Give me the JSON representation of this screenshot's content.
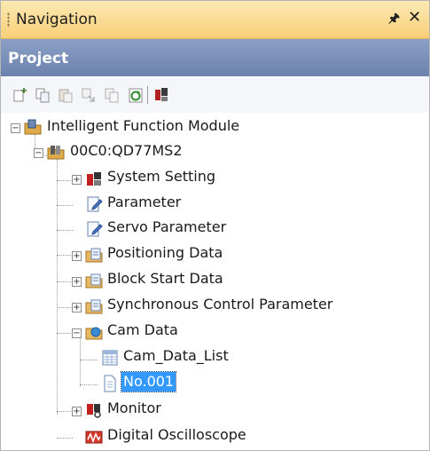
{
  "panel": {
    "title": "Navigation",
    "pin_glyph": "p ",
    "close_glyph": "×"
  },
  "project": {
    "label": "Project"
  },
  "toolbar": {
    "buttons": [
      "new-item-icon",
      "copy-icon",
      "paste-icon",
      "move-icon",
      "duplicate-icon",
      "refresh-icon",
      "properties-icon"
    ]
  },
  "tree": {
    "root": "Intelligent Function Module",
    "module": "00C0:QD77MS2",
    "items": {
      "system_setting": "System Setting",
      "parameter": "Parameter",
      "servo_parameter": "Servo Parameter",
      "positioning_data": "Positioning Data",
      "block_start_data": "Block Start Data",
      "sync_control": "Synchronous Control Parameter",
      "cam_data": "Cam Data",
      "cam_data_list": "Cam_Data_List",
      "cam_no001": "No.001",
      "monitor": "Monitor",
      "digital_oscilloscope": "Digital Oscilloscope"
    },
    "selected": "No.001"
  }
}
